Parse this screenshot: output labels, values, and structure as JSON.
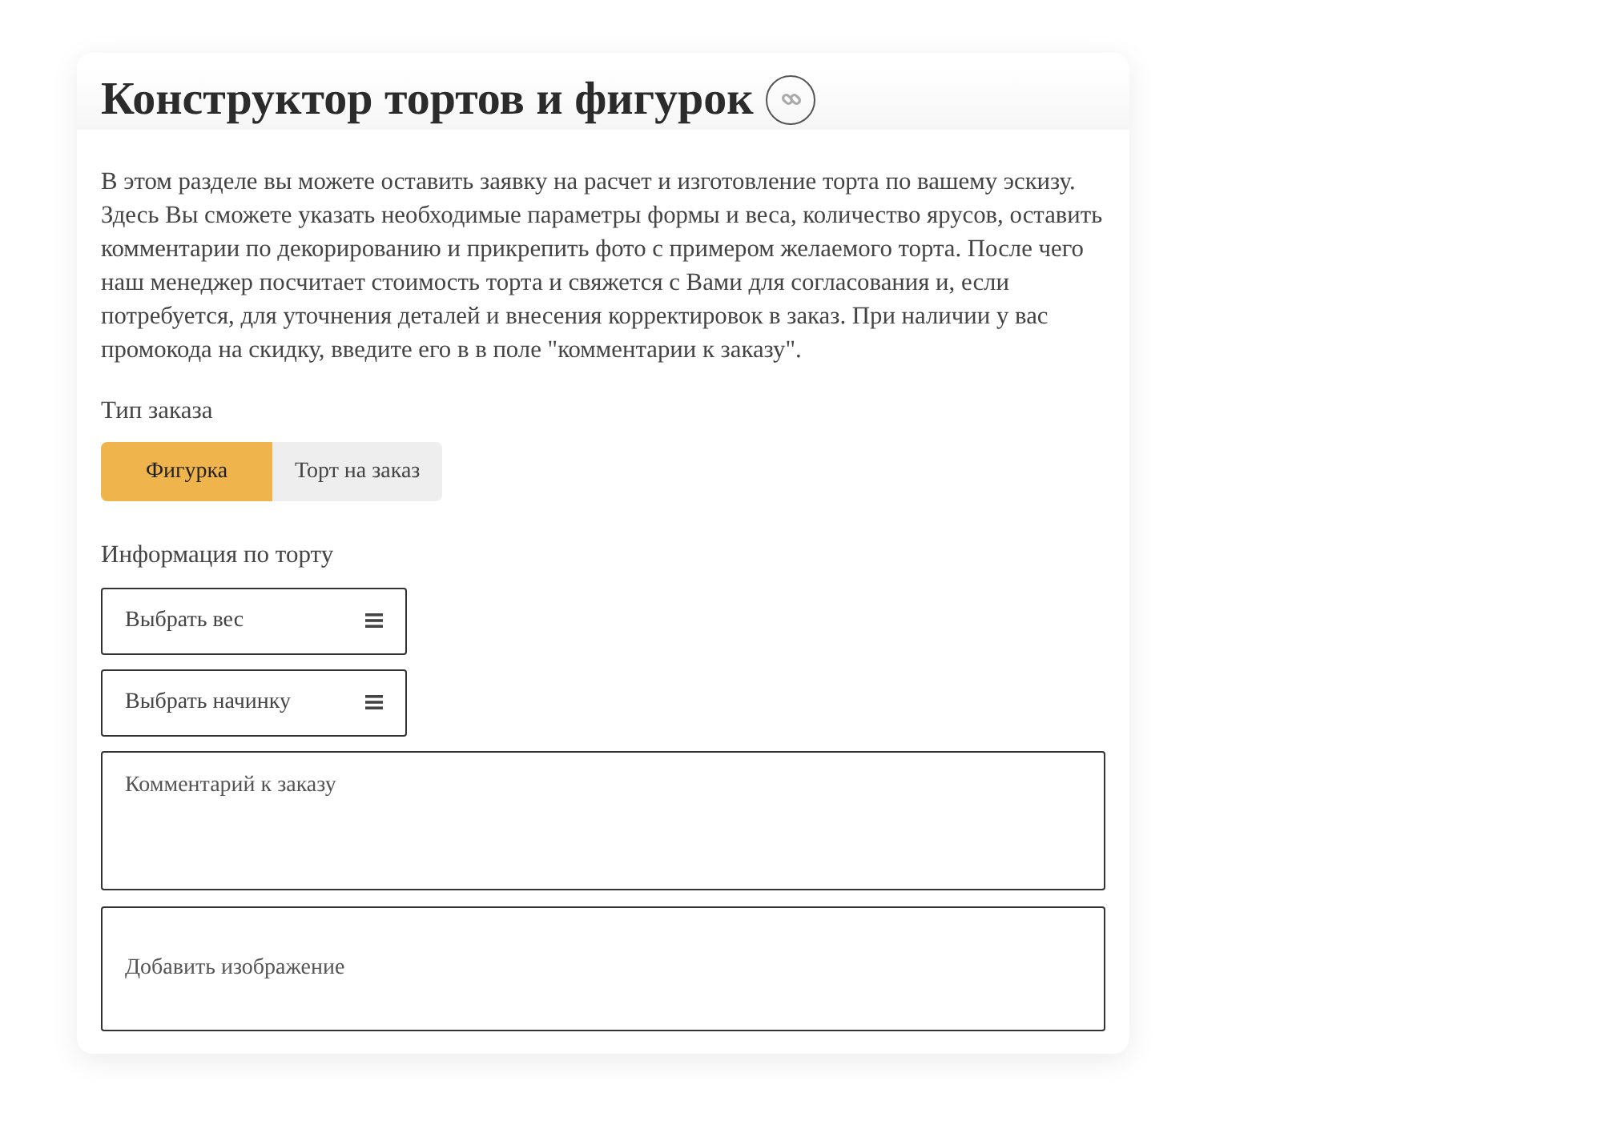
{
  "title": "Конструктор тортов и фигурок",
  "description": "В этом разделе вы можете оставить заявку на расчет и изготовление торта по вашему эскизу. Здесь Вы сможете указать необходимые параметры формы и веса, количество ярусов, оставить комментарии по декорированию и прикрепить фото с примером желаемого торта. После чего наш менеджер посчитает стоимость торта и свяжется с Вами для согласования и, если потребуется, для уточнения деталей и внесения корректировок в заказ. При наличии у вас промокода на скидку, введите его в в поле \"комментарии к заказу\".",
  "order_type": {
    "label": "Тип заказа",
    "options": [
      {
        "label": "Фигурка",
        "selected": true
      },
      {
        "label": "Торт на заказ",
        "selected": false
      }
    ]
  },
  "cake_info": {
    "label": "Информация по торту",
    "fields": [
      {
        "kind": "select",
        "placeholder": "Выбрать вес"
      },
      {
        "kind": "select",
        "placeholder": "Выбрать начинку"
      },
      {
        "kind": "textarea",
        "placeholder": "Комментарий к заказу"
      },
      {
        "kind": "upload",
        "placeholder": "Добавить изображение"
      }
    ]
  }
}
